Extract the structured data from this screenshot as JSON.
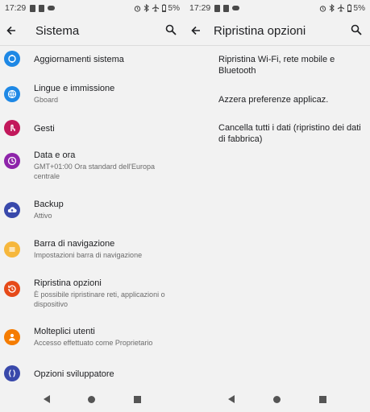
{
  "left": {
    "status": {
      "time": "17:29",
      "battery": "5%"
    },
    "title": "Sistema",
    "items": [
      {
        "title": "Aggiornamenti sistema",
        "subtitle": "",
        "color": "#1e88e5",
        "icon": "system-update-icon"
      },
      {
        "title": "Lingue e immissione",
        "subtitle": "Gboard",
        "color": "#1e88e5",
        "icon": "globe-icon"
      },
      {
        "title": "Gesti",
        "subtitle": "",
        "color": "#c2185b",
        "icon": "gesture-icon"
      },
      {
        "title": "Data e ora",
        "subtitle": "GMT+01:00 Ora standard dell'Europa centrale",
        "color": "#8e24aa",
        "icon": "clock-icon"
      },
      {
        "title": "Backup",
        "subtitle": "Attivo",
        "color": "#3949ab",
        "icon": "cloud-upload-icon"
      },
      {
        "title": "Barra di navigazione",
        "subtitle": "Impostazioni barra di navigazione",
        "color": "#f6b73c",
        "icon": "menu-lines-icon"
      },
      {
        "title": "Ripristina opzioni",
        "subtitle": "È possibile ripristinare reti, applicazioni o dispositivo",
        "color": "#e64a19",
        "icon": "restore-icon"
      },
      {
        "title": "Molteplici utenti",
        "subtitle": "Accesso effettuato come Proprietario",
        "color": "#f57c00",
        "icon": "person-icon"
      },
      {
        "title": "Opzioni sviluppatore",
        "subtitle": "",
        "color": "#3949ab",
        "icon": "braces-icon"
      }
    ]
  },
  "right": {
    "status": {
      "time": "17:29",
      "battery": "5%"
    },
    "title": "Ripristina opzioni",
    "options": [
      "Ripristina Wi-Fi, rete mobile e Bluetooth",
      "Azzera preferenze applicaz.",
      "Cancella tutti i dati (ripristino dei dati di fabbrica)"
    ]
  }
}
